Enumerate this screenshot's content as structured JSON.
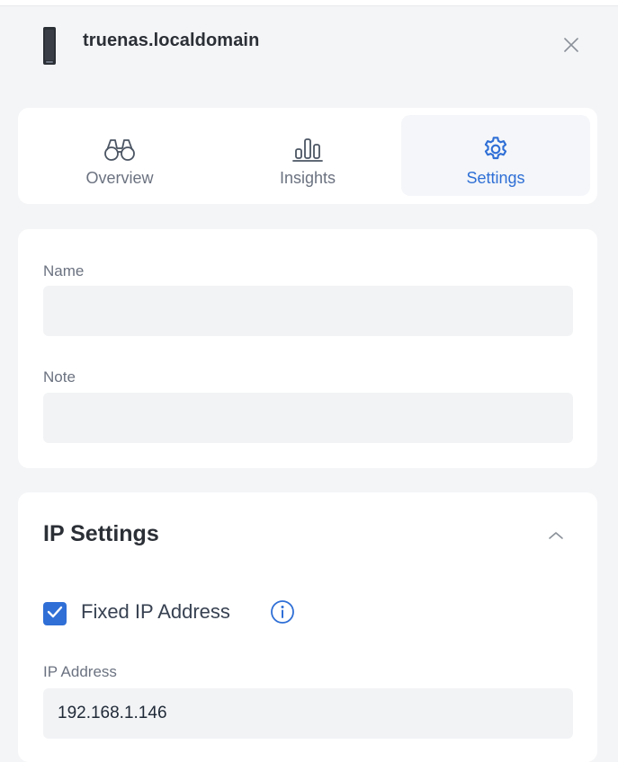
{
  "header": {
    "title": "truenas.localdomain",
    "device_icon": "server-tower-icon",
    "close_icon": "close-icon"
  },
  "tabs": [
    {
      "label": "Overview",
      "icon": "binoculars-icon",
      "active": false
    },
    {
      "label": "Insights",
      "icon": "bar-chart-icon",
      "active": false
    },
    {
      "label": "Settings",
      "icon": "gear-icon",
      "active": true
    }
  ],
  "form": {
    "name_label": "Name",
    "name_value": "",
    "note_label": "Note",
    "note_value": ""
  },
  "ip_settings": {
    "title": "IP Settings",
    "collapse_icon": "chevron-up-icon",
    "fixed_ip_label": "Fixed IP Address",
    "fixed_ip_checked": true,
    "info_icon": "info-icon",
    "ip_label": "IP Address",
    "ip_value": "192.168.1.146"
  },
  "colors": {
    "accent": "#2f6fd6",
    "muted_text": "#6b7280",
    "field_bg": "#f2f3f5",
    "page_bg": "#f4f5f7"
  }
}
